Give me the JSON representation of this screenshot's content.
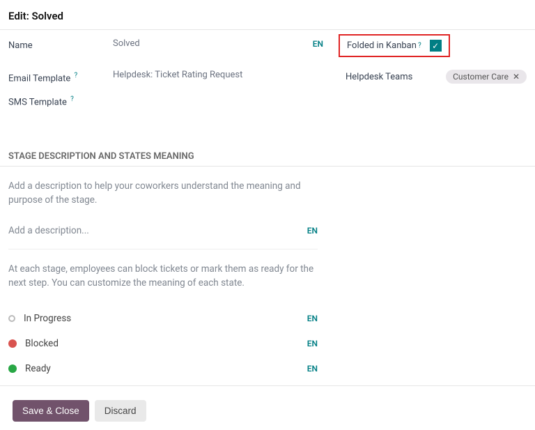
{
  "title": "Edit: Solved",
  "left": {
    "name_label": "Name",
    "name_value": "Solved",
    "email_label": "Email Template",
    "email_value": "Helpdesk: Ticket Rating Request",
    "sms_label": "SMS Template"
  },
  "right": {
    "fold_label": "Folded in Kanban",
    "fold_checked": true,
    "teams_label": "Helpdesk Teams",
    "team_tag": "Customer Care"
  },
  "lang": "EN",
  "help": "?",
  "section_title": "STAGE DESCRIPTION AND STATES MEANING",
  "hint1": "Add a description to help your coworkers understand the meaning and purpose of the stage.",
  "desc_placeholder": "Add a description...",
  "hint2": "At each stage, employees can block tickets or mark them as ready for the next step. You can customize the meaning of each state.",
  "states": [
    {
      "label": "In Progress",
      "color": "grey"
    },
    {
      "label": "Blocked",
      "color": "red"
    },
    {
      "label": "Ready",
      "color": "green"
    }
  ],
  "buttons": {
    "save": "Save & Close",
    "discard": "Discard"
  },
  "close_glyph": "✕",
  "check_glyph": "✓"
}
